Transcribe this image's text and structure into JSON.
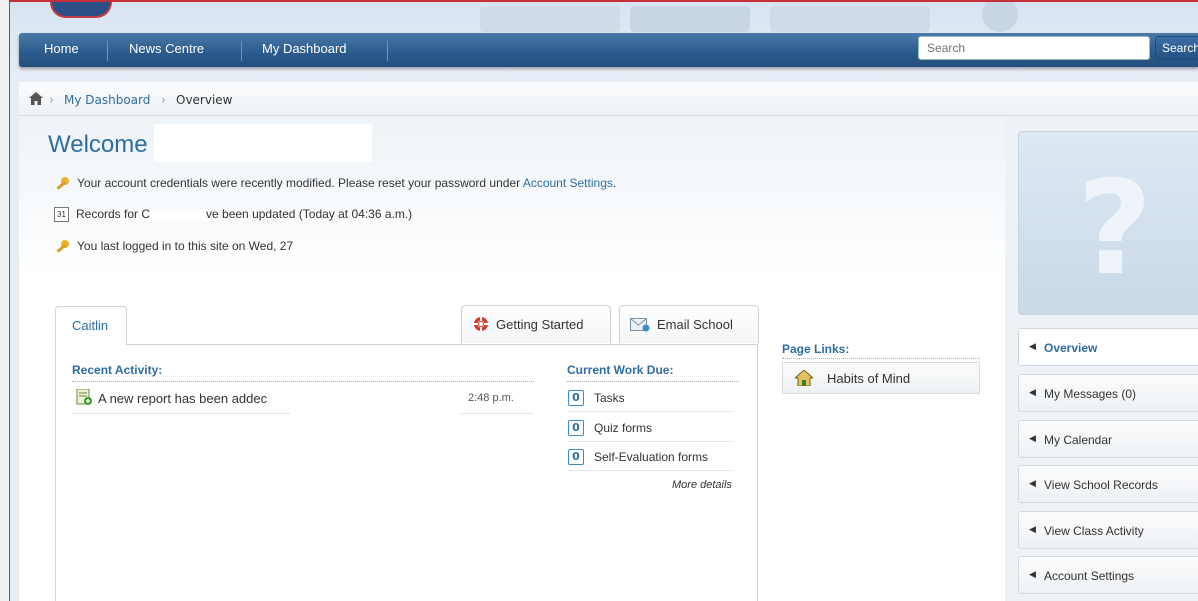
{
  "nav": {
    "items": [
      {
        "label": "Home"
      },
      {
        "label": "News Centre"
      },
      {
        "label": "My Dashboard"
      }
    ],
    "search_placeholder": "Search",
    "search_button": "Search"
  },
  "breadcrumb": {
    "items": [
      "My Dashboard",
      "Overview"
    ]
  },
  "welcome": {
    "title": "Welcome",
    "messages": {
      "credentials": "Your account credentials were recently modified. Please reset your password under",
      "credentials_link": "Account Settings",
      "credentials_end": ".",
      "records_prefix": "Records for C",
      "records_suffix": "ve been updated (Today at 04:36 a.m.)",
      "calendar_badge": "31",
      "last_login": "You last logged in to this site on Wed, 27"
    }
  },
  "tabs": {
    "student": "Caitlin",
    "getting_started": "Getting Started",
    "email_school": "Email School"
  },
  "recent_activity": {
    "heading": "Recent Activity:",
    "items": [
      {
        "text": "A new report has been addec",
        "time": "2:48 p.m."
      }
    ]
  },
  "work_due": {
    "heading": "Current Work Due:",
    "items": [
      {
        "count": "0",
        "label": "Tasks"
      },
      {
        "count": "0",
        "label": "Quiz forms"
      },
      {
        "count": "0",
        "label": "Self-Evaluation forms"
      }
    ],
    "more": "More details"
  },
  "page_links": {
    "heading": "Page Links:",
    "items": [
      {
        "label": "Habits of Mind"
      }
    ]
  },
  "sidebar": {
    "avatar_glyph": "?",
    "items": [
      {
        "label": "Overview",
        "active": true
      },
      {
        "label": "My Messages (0)"
      },
      {
        "label": "My Calendar"
      },
      {
        "label": "View School Records"
      },
      {
        "label": "View Class Activity"
      },
      {
        "label": "Account Settings"
      }
    ]
  },
  "colors": {
    "nav_blue": "#2d5c8e",
    "link_blue": "#2e6da4",
    "frame_red": "#c2303a"
  }
}
